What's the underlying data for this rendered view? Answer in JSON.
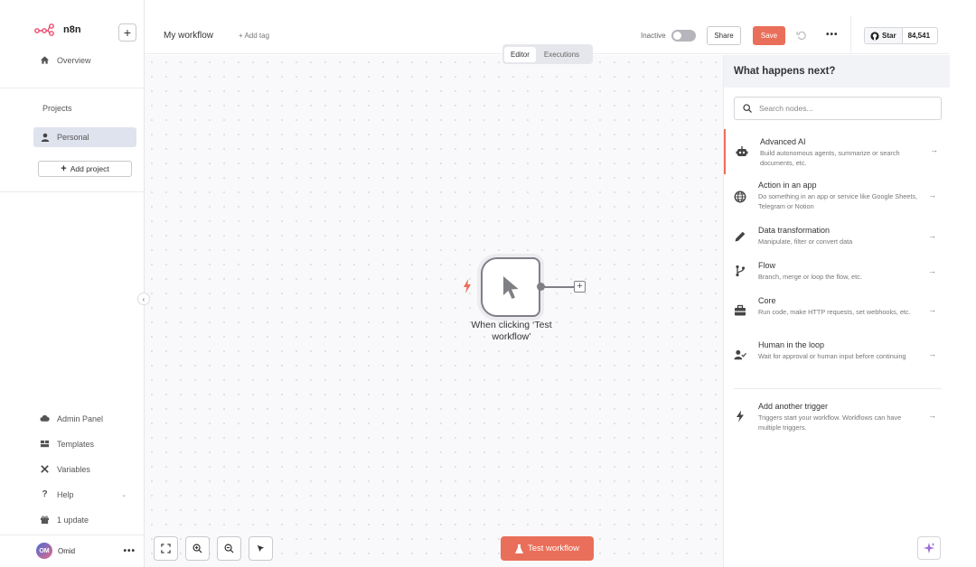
{
  "app": {
    "name": "n8n"
  },
  "sidebar": {
    "overview_label": "Overview",
    "projects_label": "Projects",
    "personal_label": "Personal",
    "add_project_label": "Add project",
    "bottom_items": [
      {
        "label": "Admin Panel",
        "icon": "cloud-icon"
      },
      {
        "label": "Templates",
        "icon": "templates-icon"
      },
      {
        "label": "Variables",
        "icon": "variables-icon"
      },
      {
        "label": "Help",
        "icon": "help-icon"
      },
      {
        "label": "1 update",
        "icon": "gift-icon"
      }
    ],
    "user": {
      "initials": "OM",
      "name": "Omid"
    }
  },
  "header": {
    "workflow_name": "My workflow",
    "add_tag_label": "+ Add tag",
    "inactive_label": "Inactive",
    "share_label": "Share",
    "save_label": "Save",
    "more_label": "•••",
    "star_label": "Star",
    "star_count": "84,541"
  },
  "tabs": {
    "editor": "Editor",
    "executions": "Executions"
  },
  "canvas": {
    "node_label": "When clicking ‘Test workflow’",
    "test_button_label": "Test workflow"
  },
  "panel": {
    "title": "What happens next?",
    "search_placeholder": "Search nodes...",
    "categories": [
      {
        "title": "Advanced AI",
        "desc": "Build autonomous agents, summarize or search documents, etc.",
        "icon": "robot-icon"
      },
      {
        "title": "Action in an app",
        "desc": "Do something in an app or service like Google Sheets, Telegram or Notion",
        "icon": "globe-icon"
      },
      {
        "title": "Data transformation",
        "desc": "Manipulate, filter or convert data",
        "icon": "pencil-icon"
      },
      {
        "title": "Flow",
        "desc": "Branch, merge or loop the flow, etc.",
        "icon": "branch-icon"
      },
      {
        "title": "Core",
        "desc": "Run code, make HTTP requests, set webhooks, etc.",
        "icon": "toolbox-icon"
      },
      {
        "title": "Human in the loop",
        "desc": "Wait for approval or human input before continuing",
        "icon": "user-check-icon"
      },
      {
        "title": "Add another trigger",
        "desc": "Triggers start your workflow. Workflows can have multiple triggers.",
        "icon": "bolt-icon"
      }
    ]
  },
  "colors": {
    "accent": "#ea6f5a",
    "logo": "#ea4b71"
  }
}
